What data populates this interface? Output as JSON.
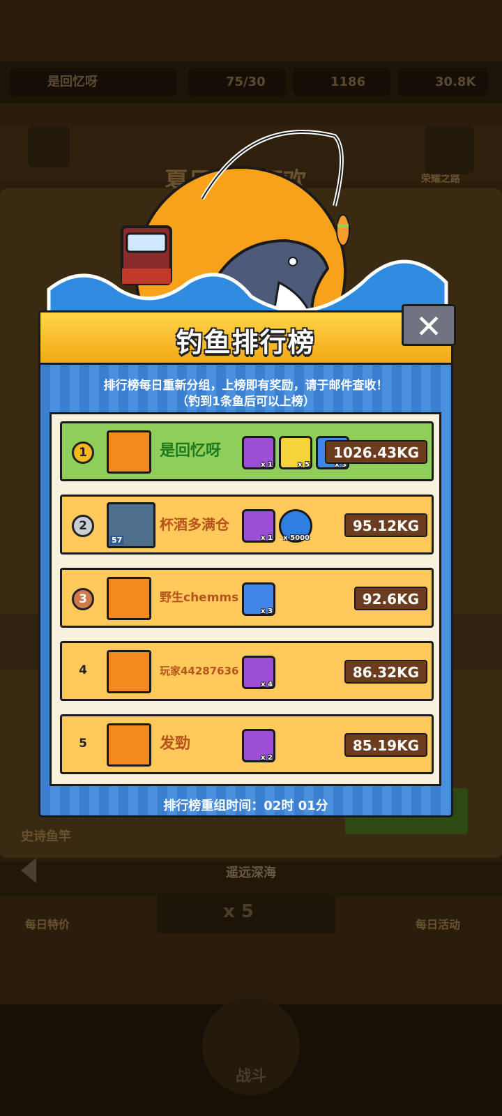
{
  "background": {
    "player_name": "是回忆呀",
    "stamina": "75/30",
    "currency_a": "1186",
    "currency_b": "30.8K",
    "event_banner": "夏日海钓狂欢",
    "rod_label": "史诗鱼竿",
    "location": "遥远深海",
    "bait_count": "x 5",
    "left_label": "每日特价",
    "right_label": "每日活动",
    "right_top_label": "荣耀之路",
    "battle_label": "战斗"
  },
  "panel": {
    "title": "钓鱼排行榜",
    "close_glyph": "✕",
    "notice_line1": "排行榜每日重新分组，上榜即有奖励，请于邮件查收！",
    "notice_line2": "（钓到1条鱼后可以上榜）",
    "reset_timer": "排行榜重组时间：02时 01分"
  },
  "leaderboard": [
    {
      "rank": "1",
      "name": "是回忆呀",
      "weight": "1026.43KG",
      "rewards": [
        {
          "icon": "purple-chest-icon",
          "qty": "x 1"
        },
        {
          "icon": "key-icon",
          "qty": "x 5"
        },
        {
          "icon": "blue-chest-icon",
          "qty": "x 3"
        }
      ]
    },
    {
      "rank": "2",
      "name": "杯酒多满仓",
      "weight": "95.12KG",
      "level_badge": "57",
      "rewards": [
        {
          "icon": "purple-chest-icon",
          "qty": "x 1"
        },
        {
          "icon": "gold-coin-icon",
          "qty": "x 5000"
        }
      ]
    },
    {
      "rank": "3",
      "name": "野生chemms",
      "weight": "92.6KG",
      "rewards": [
        {
          "icon": "blue-chest-icon",
          "qty": "x 3"
        }
      ]
    },
    {
      "rank": "4",
      "name": "玩家44287636",
      "weight": "86.32KG",
      "rewards": [
        {
          "icon": "fish-lure-icon",
          "qty": "x 4"
        }
      ]
    },
    {
      "rank": "5",
      "name": "发勁",
      "weight": "85.19KG",
      "rewards": [
        {
          "icon": "fish-lure-icon",
          "qty": "x 2"
        }
      ]
    }
  ],
  "colors": {
    "panel_blue": "#3a7fd0",
    "banner_yellow": "#ffd54a",
    "row_gold": "#ffc95c",
    "row_first": "#8fce5a",
    "weight_bg": "#6b3d1e",
    "name_first": "#1f7a1f",
    "name_other": "#b5551c"
  }
}
